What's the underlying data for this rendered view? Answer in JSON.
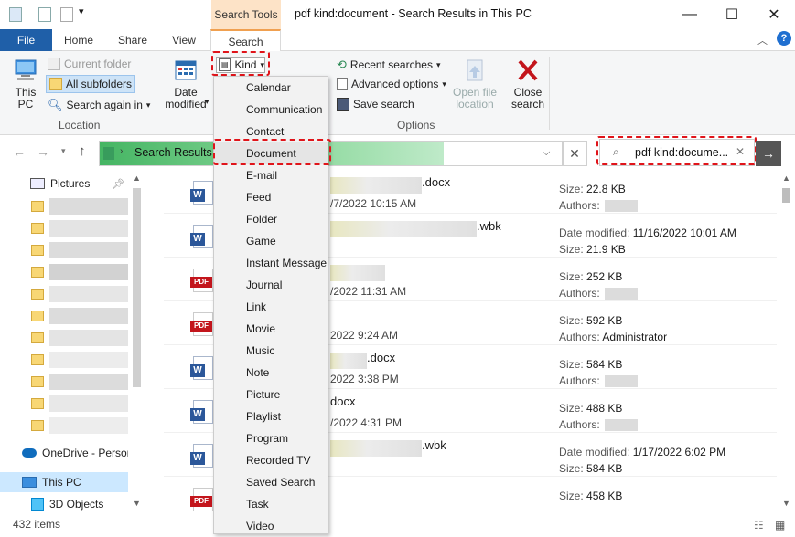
{
  "window": {
    "context_tab": "Search Tools",
    "title": "pdf kind:document - Search Results in This PC",
    "minimize": "—",
    "maximize": "☐",
    "close": "✕"
  },
  "ribbon": {
    "tabs": [
      "File",
      "Home",
      "Share",
      "View",
      "Search"
    ],
    "help": "?",
    "this_pc": "This PC",
    "current_folder": "Current folder",
    "all_subfolders": "All subfolders",
    "search_again_in": "Search again in",
    "location_label": "Location",
    "date_modified": "Date modified",
    "kind": "Kind",
    "recent_searches": "Recent searches",
    "advanced_options": "Advanced options",
    "save_search": "Save search",
    "open_file_location": "Open file location",
    "close_search": "Close search",
    "options_label": "Options"
  },
  "address": {
    "path": "Search Results i",
    "search_query": "pdf kind:docume..."
  },
  "nav": {
    "pictures": "Pictures",
    "onedrive": "OneDrive - Person",
    "this_pc": "This PC",
    "objects_3d": "3D Objects"
  },
  "files": [
    {
      "type": "word",
      "name_suffix": ".docx",
      "date": "/7/2022 10:15 AM",
      "meta1_label": "Size:",
      "meta1_value": "22.8 KB",
      "meta2_label": "Authors:",
      "meta2_value": ""
    },
    {
      "type": "word",
      "name_suffix": ".wbk",
      "date": "",
      "meta1_label": "Date modified:",
      "meta1_value": "11/16/2022 10:01 AM",
      "meta2_label": "Size:",
      "meta2_value": "21.9 KB"
    },
    {
      "type": "pdf",
      "name_suffix": "",
      "date": "/2022 11:31 AM",
      "meta1_label": "Size:",
      "meta1_value": "252 KB",
      "meta2_label": "Authors:",
      "meta2_value": ""
    },
    {
      "type": "pdf",
      "name_suffix": "",
      "date": "2022 9:24 AM",
      "meta1_label": "Size:",
      "meta1_value": "592 KB",
      "meta2_label": "Authors:",
      "meta2_value": "Administrator"
    },
    {
      "type": "word",
      "name_suffix": ".docx",
      "date": "2022 3:38 PM",
      "meta1_label": "Size:",
      "meta1_value": "584 KB",
      "meta2_label": "Authors:",
      "meta2_value": ""
    },
    {
      "type": "word",
      "name_suffix": "docx",
      "date": "/2022 4:31 PM",
      "meta1_label": "Size:",
      "meta1_value": "488 KB",
      "meta2_label": "Authors:",
      "meta2_value": ""
    },
    {
      "type": "word",
      "name_suffix": ".wbk",
      "date": "",
      "meta1_label": "Date modified:",
      "meta1_value": "1/17/2022 6:02 PM",
      "meta2_label": "Size:",
      "meta2_value": "584 KB"
    },
    {
      "type": "pdf",
      "name_suffix": "",
      "date": "",
      "meta1_label": "Size:",
      "meta1_value": "458 KB",
      "meta2_label": "",
      "meta2_value": ""
    }
  ],
  "kind_menu": [
    "Calendar",
    "Communication",
    "Contact",
    "Document",
    "E-mail",
    "Feed",
    "Folder",
    "Game",
    "Instant Message",
    "Journal",
    "Link",
    "Movie",
    "Music",
    "Note",
    "Picture",
    "Playlist",
    "Program",
    "Recorded TV",
    "Saved Search",
    "Task",
    "Video"
  ],
  "kind_selected": "Document",
  "status": {
    "items": "432 items"
  },
  "colors": {
    "highlight": "#e0141a",
    "file_tab": "#1f5fa8",
    "accent_context": "#fde3c7"
  }
}
